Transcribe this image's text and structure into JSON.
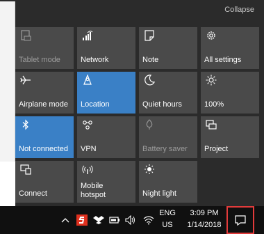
{
  "panel": {
    "collapse_label": "Collapse"
  },
  "tiles": [
    {
      "label": "Tablet mode",
      "icon": "tablet-mode-icon",
      "active": false,
      "disabled": true
    },
    {
      "label": "Network",
      "icon": "network-icon",
      "active": false,
      "disabled": false
    },
    {
      "label": "Note",
      "icon": "note-icon",
      "active": false,
      "disabled": false
    },
    {
      "label": "All settings",
      "icon": "gear-icon",
      "active": false,
      "disabled": false
    },
    {
      "label": "Airplane mode",
      "icon": "airplane-icon",
      "active": false,
      "disabled": false
    },
    {
      "label": "Location",
      "icon": "location-icon",
      "active": true,
      "disabled": false
    },
    {
      "label": "Quiet hours",
      "icon": "moon-icon",
      "active": false,
      "disabled": false
    },
    {
      "label": "100%",
      "icon": "brightness-icon",
      "active": false,
      "disabled": false
    },
    {
      "label": "Not connected",
      "icon": "bluetooth-icon",
      "active": true,
      "disabled": false
    },
    {
      "label": "VPN",
      "icon": "vpn-icon",
      "active": false,
      "disabled": false
    },
    {
      "label": "Battery saver",
      "icon": "battery-saver-icon",
      "active": false,
      "disabled": true
    },
    {
      "label": "Project",
      "icon": "project-icon",
      "active": false,
      "disabled": false
    },
    {
      "label": "Connect",
      "icon": "connect-icon",
      "active": false,
      "disabled": false
    },
    {
      "label": "Mobile\nhotspot",
      "icon": "hotspot-icon",
      "active": false,
      "disabled": false
    },
    {
      "label": "Night light",
      "icon": "night-light-icon",
      "active": false,
      "disabled": false
    }
  ],
  "taskbar": {
    "language_line1": "ENG",
    "language_line2": "US",
    "time": "3:09 PM",
    "date": "1/14/2018",
    "tray_icons": [
      "chevron-up-icon",
      "app-red-icon",
      "dropbox-icon",
      "battery-icon",
      "volume-icon",
      "wifi-icon"
    ]
  },
  "colors": {
    "panel_bg": "#2b2b2b",
    "tile_bg": "#4a4a4a",
    "tile_active": "#3a80c6",
    "taskbar_bg": "#101010",
    "highlight": "#e23b3b"
  }
}
